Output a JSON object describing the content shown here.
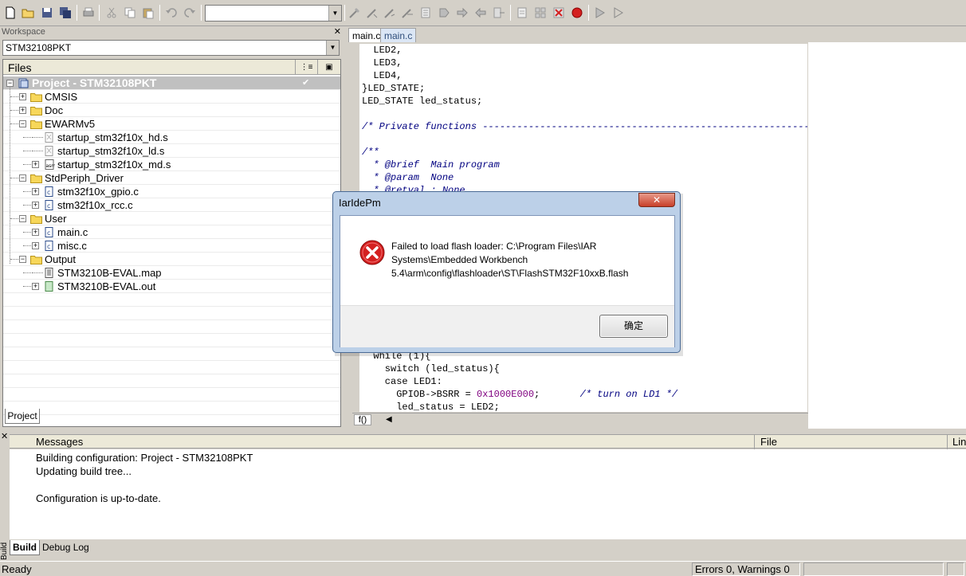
{
  "workspace": {
    "title": "Workspace",
    "selected_config": "STM32108PKT",
    "files_header": "Files",
    "tab": "Project",
    "tree": [
      {
        "label": "Project - STM32108PKT",
        "level": 0,
        "type": "project",
        "expander": "minus",
        "selected": true,
        "check": "✔"
      },
      {
        "label": "CMSIS",
        "level": 1,
        "type": "folder",
        "expander": "plus"
      },
      {
        "label": "Doc",
        "level": 1,
        "type": "folder",
        "expander": "plus"
      },
      {
        "label": "EWARMv5",
        "level": 1,
        "type": "folder",
        "expander": "minus"
      },
      {
        "label": "startup_stm32f10x_hd.s",
        "level": 2,
        "type": "file-x",
        "expander": "none"
      },
      {
        "label": "startup_stm32f10x_ld.s",
        "level": 2,
        "type": "file-x",
        "expander": "none"
      },
      {
        "label": "startup_stm32f10x_md.s",
        "level": 2,
        "type": "file-asm",
        "expander": "plus"
      },
      {
        "label": "StdPeriph_Driver",
        "level": 1,
        "type": "folder",
        "expander": "minus"
      },
      {
        "label": "stm32f10x_gpio.c",
        "level": 2,
        "type": "file-c",
        "expander": "plus"
      },
      {
        "label": "stm32f10x_rcc.c",
        "level": 2,
        "type": "file-c",
        "expander": "plus"
      },
      {
        "label": "User",
        "level": 1,
        "type": "folder",
        "expander": "minus"
      },
      {
        "label": "main.c",
        "level": 2,
        "type": "file-c",
        "expander": "plus"
      },
      {
        "label": "misc.c",
        "level": 2,
        "type": "file-c",
        "expander": "plus"
      },
      {
        "label": "Output",
        "level": 1,
        "type": "folder",
        "expander": "minus"
      },
      {
        "label": "STM3210B-EVAL.map",
        "level": 2,
        "type": "file-doc",
        "expander": "none"
      },
      {
        "label": "STM3210B-EVAL.out",
        "level": 2,
        "type": "file-out",
        "expander": "plus"
      }
    ]
  },
  "editor": {
    "tabs": [
      "main.c",
      "main.c"
    ],
    "scroll_label": "f()",
    "lines": [
      {
        "text": "  LED2,",
        "cls": ""
      },
      {
        "text": "  LED3,",
        "cls": ""
      },
      {
        "text": "  LED4,",
        "cls": ""
      },
      {
        "text": "}LED_STATE;",
        "cls": ""
      },
      {
        "text": "LED_STATE led_status;",
        "cls": ""
      },
      {
        "text": "",
        "cls": ""
      },
      {
        "text": "/* Private functions ---------------------------------------------------------*/",
        "cls": "cm"
      },
      {
        "text": "",
        "cls": ""
      },
      {
        "text": "/**",
        "cls": "cm"
      },
      {
        "text": "  * @brief  Main program",
        "cls": "cm"
      },
      {
        "text": "  * @param  None",
        "cls": "cm"
      },
      {
        "text": "  * @retval : None",
        "cls": "cm"
      },
      {
        "text": "",
        "cls": ""
      },
      {
        "text": "",
        "cls": ""
      },
      {
        "text": "",
        "cls": ""
      },
      {
        "text": "",
        "cls": ""
      },
      {
        "text": "",
        "cls": ""
      },
      {
        "text": "",
        "cls": ""
      },
      {
        "text": "",
        "cls": ""
      },
      {
        "text": "",
        "cls": ""
      },
      {
        "text": "",
        "cls": ""
      },
      {
        "text": "",
        "cls": ""
      },
      {
        "text": "",
        "cls": ""
      },
      {
        "text": "",
        "cls": ""
      },
      {
        "text": "  while (1){",
        "cls": ""
      },
      {
        "text": "    switch (led_status){",
        "cls": ""
      },
      {
        "text": "    case LED1:",
        "cls": ""
      },
      {
        "text": "      GPIOB->BSRR = 0x1000E000;       /* turn on LD1 */",
        "cls": "mixed"
      },
      {
        "text": "      led_status = LED2;",
        "cls": ""
      }
    ]
  },
  "messages": {
    "headers": {
      "messages": "Messages",
      "file": "File",
      "line": "Line"
    },
    "lines": [
      "Building configuration: Project - STM32108PKT",
      "Updating build tree...",
      "",
      "Configuration is up-to-date."
    ],
    "tabs": {
      "build": "Build",
      "debug": "Debug Log"
    },
    "side_label": "Build"
  },
  "status": {
    "ready": "Ready",
    "errors": "Errors 0, Warnings 0"
  },
  "dialog": {
    "title": "IarIdePm",
    "close": "✕",
    "message": "Failed to load flash loader: C:\\Program Files\\IAR Systems\\Embedded Workbench 5.4\\arm\\config\\flashloader\\ST\\FlashSTM32F10xxB.flash",
    "ok": "确定"
  },
  "colors": {
    "selection": "#c0c0c0",
    "comment": "#000080",
    "number": "#800080",
    "dialog_border": "#4a6a95",
    "error_red": "#d42020"
  }
}
